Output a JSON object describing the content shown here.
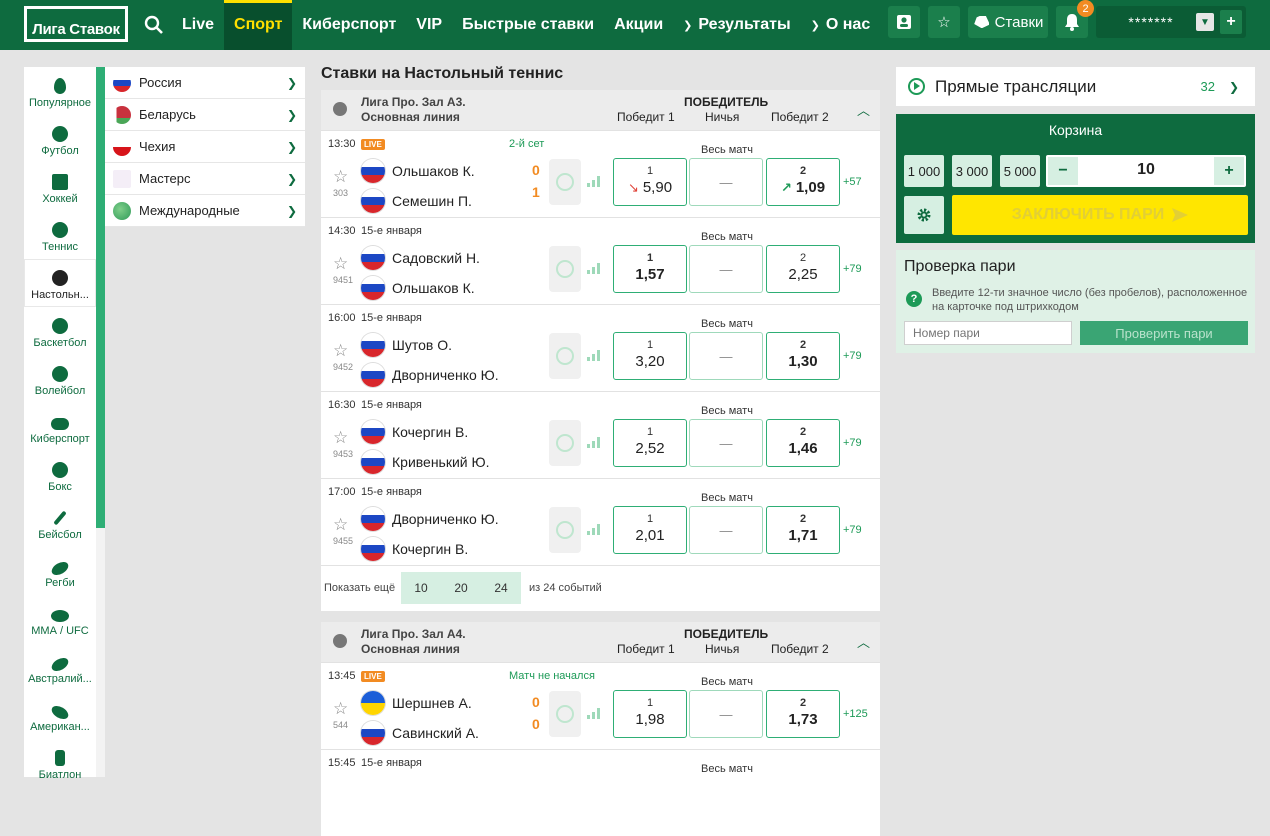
{
  "header": {
    "logo": "Лига Ставок",
    "nav": [
      "Live",
      "Спорт",
      "Киберспорт",
      "VIP",
      "Быстрые ставки",
      "Акции",
      "Результаты",
      "О нас"
    ],
    "bets_label": "Ставки",
    "notifications": "2",
    "password_mask": "*******"
  },
  "sports": [
    "Популярное",
    "Футбол",
    "Хоккей",
    "Теннис",
    "Настольн...",
    "Баскетбол",
    "Волейбол",
    "Киберспорт",
    "Бокс",
    "Бейсбол",
    "Регби",
    "ММА / UFC",
    "Австралий...",
    "Американ...",
    "Биатлон"
  ],
  "countries": [
    "Россия",
    "Беларусь",
    "Чехия",
    "Мастерс",
    "Международные"
  ],
  "page_title": "Ставки на Настольный теннис",
  "leagues": [
    {
      "name": "Лига Про. Зал А3.",
      "line": "Основная линия",
      "winner": "ПОБЕДИТЕЛЬ",
      "cols": [
        "Победит 1",
        "Ничья",
        "Победит 2"
      ],
      "matches": [
        {
          "time": "13:30",
          "live": "LIVE",
          "status": "2-й сет",
          "id": "303",
          "t1": "Ольшаков К.",
          "t2": "Семешин П.",
          "s1": "0",
          "s2": "1",
          "full": "Весь матч",
          "o1": "5,90",
          "o2": "1,09",
          "more": "+57"
        },
        {
          "time": "14:30",
          "date": "15-е января",
          "id": "9451",
          "t1": "Садовский Н.",
          "t2": "Ольшаков К.",
          "full": "Весь матч",
          "o1": "1,57",
          "o2": "2,25",
          "more": "+79"
        },
        {
          "time": "16:00",
          "date": "15-е января",
          "id": "9452",
          "t1": "Шутов О.",
          "t2": "Дворниченко Ю.",
          "full": "Весь матч",
          "o1": "3,20",
          "o2": "1,30",
          "more": "+79"
        },
        {
          "time": "16:30",
          "date": "15-е января",
          "id": "9453",
          "t1": "Кочергин В.",
          "t2": "Кривенький Ю.",
          "full": "Весь матч",
          "o1": "2,52",
          "o2": "1,46",
          "more": "+79"
        },
        {
          "time": "17:00",
          "date": "15-е января",
          "id": "9455",
          "t1": "Дворниченко Ю.",
          "t2": "Кочергин В.",
          "full": "Весь матч",
          "o1": "2,01",
          "o2": "1,71",
          "more": "+79"
        }
      ],
      "show_more": "Показать ещё",
      "pages": [
        "10",
        "20",
        "24"
      ],
      "total": "из 24 событий"
    },
    {
      "name": "Лига Про. Зал А4.",
      "line": "Основная линия",
      "winner": "ПОБЕДИТЕЛЬ",
      "cols": [
        "Победит 1",
        "Ничья",
        "Победит 2"
      ],
      "matches": [
        {
          "time": "13:45",
          "live": "LIVE",
          "status": "Матч не начался",
          "id": "544",
          "t1": "Шершнев А.",
          "t2": "Савинский А.",
          "s1": "0",
          "s2": "0",
          "full": "Весь матч",
          "o1": "1,98",
          "o2": "1,73",
          "more": "+125"
        },
        {
          "time": "15:45",
          "date": "15-е января",
          "full": "Весь матч"
        }
      ]
    }
  ],
  "odd_labels": {
    "w1": "1",
    "draw": "—",
    "w2": "2"
  },
  "live_panel": {
    "title": "Прямые трансляции",
    "count": "32"
  },
  "cart": {
    "title": "Корзина",
    "chips": [
      "1 000",
      "3 000",
      "5 000"
    ],
    "stake": "10",
    "place": "ЗАКЛЮЧИТЬ ПАРИ"
  },
  "check": {
    "title": "Проверка пари",
    "desc": "Введите 12-ти значное число (без пробелов), расположенное на карточке под штрихкодом",
    "placeholder": "Номер пари",
    "button": "Проверить пари"
  }
}
